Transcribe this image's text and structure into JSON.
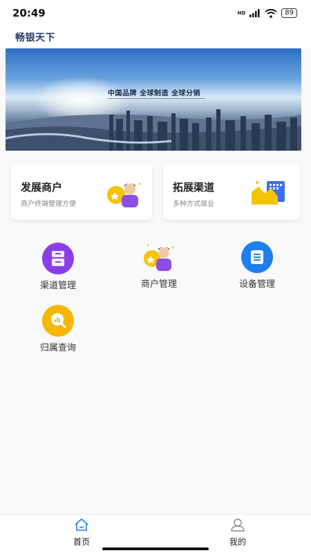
{
  "status_bar": {
    "time": "20:49",
    "battery": "89",
    "network": "HD"
  },
  "header": {
    "title": "畅银天下"
  },
  "banner": {
    "text": "中国品牌  全球制造  全球分销"
  },
  "cards": [
    {
      "title": "发展商户",
      "subtitle": "商户终端管理方便",
      "icon": "merchant-star-icon"
    },
    {
      "title": "拓展渠道",
      "subtitle": "多种方式展业",
      "icon": "channel-chart-icon"
    }
  ],
  "grid": [
    {
      "label": "渠道管理",
      "icon": "archive-icon",
      "color": "#8a3ee8"
    },
    {
      "label": "商户管理",
      "icon": "merchant-icon",
      "color": "#f5b800"
    },
    {
      "label": "设备管理",
      "icon": "document-icon",
      "color": "#1e7ff0"
    },
    {
      "label": "归属查询",
      "icon": "search-chart-icon",
      "color": "#f5b800"
    }
  ],
  "nav": {
    "home_label": "首页",
    "mine_label": "我的"
  },
  "colors": {
    "accent_blue": "#1e7ff0",
    "accent_purple": "#8a3ee8",
    "accent_yellow": "#f5b800",
    "title_blue": "#2a3d6b"
  }
}
